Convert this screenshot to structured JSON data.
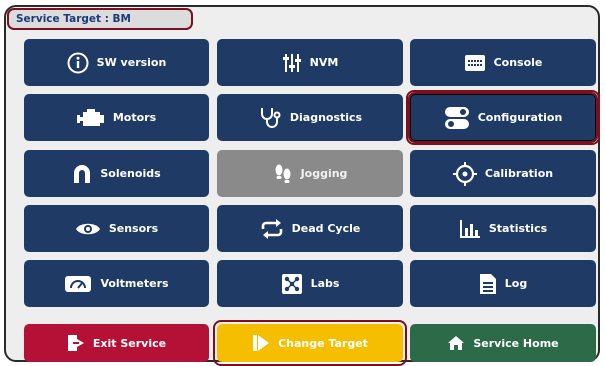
{
  "header": {
    "service_target": "Service Target : BM"
  },
  "colors": {
    "primary": "#1f3a64",
    "disabled": "#8a8a8a",
    "exit": "#b51035",
    "change": "#f5be00",
    "home": "#2c6a48",
    "highlight": "#7a1020"
  },
  "grid": [
    {
      "label": "SW version",
      "icon": "info-icon"
    },
    {
      "label": "NVM",
      "icon": "sliders-icon"
    },
    {
      "label": "Console",
      "icon": "keyboard-icon"
    },
    {
      "label": "Motors",
      "icon": "engine-icon"
    },
    {
      "label": "Diagnostics",
      "icon": "stethoscope-icon"
    },
    {
      "label": "Configuration",
      "icon": "toggles-icon",
      "selected": true
    },
    {
      "label": "Solenoids",
      "icon": "magnet-icon"
    },
    {
      "label": "Jogging",
      "icon": "footprints-icon",
      "disabled": true
    },
    {
      "label": "Calibration",
      "icon": "crosshair-icon"
    },
    {
      "label": "Sensors",
      "icon": "eye-icon"
    },
    {
      "label": "Dead Cycle",
      "icon": "repeat-icon"
    },
    {
      "label": "Statistics",
      "icon": "bar-chart-icon"
    },
    {
      "label": "Voltmeters",
      "icon": "gauge-icon"
    },
    {
      "label": "Labs",
      "icon": "labs-icon"
    },
    {
      "label": "Log",
      "icon": "document-icon"
    }
  ],
  "footer": {
    "exit_label": "Exit Service",
    "change_label": "Change Target",
    "home_label": "Service Home"
  }
}
